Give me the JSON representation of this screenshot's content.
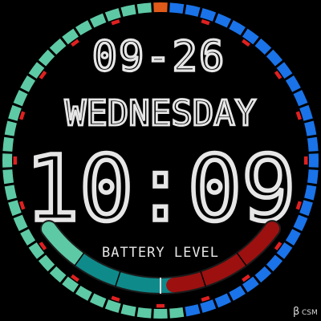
{
  "watch": {
    "date": "09-26",
    "weekday": "WEDNESDAY",
    "time": "10:09",
    "battery_label": "BATTERY LEVEL",
    "battery_level": 0.55,
    "brand_symbol": "β",
    "brand_text": "CSM"
  },
  "colors": {
    "background": "#000000",
    "ring_green": "#5ec9a5",
    "ring_blue": "#1a73e8",
    "ring_marker": "#e02020",
    "ring_top": "#e05a1a",
    "battery_track": "#1a1a1a",
    "battery_light": "#5ec9a5",
    "battery_dark": "#0f8a8a",
    "battery_red": "#9c1010",
    "text": "#e6e6e6"
  },
  "ring": {
    "segments": 60,
    "markers": [
      3,
      6,
      9,
      12,
      15,
      18,
      21,
      24,
      27,
      30,
      33,
      36,
      39,
      42,
      45,
      48,
      51,
      54,
      57
    ]
  },
  "icons": {
    "outer_ring": "segmented-seconds-ring-icon",
    "battery_arc": "battery-arc-gauge-icon"
  }
}
